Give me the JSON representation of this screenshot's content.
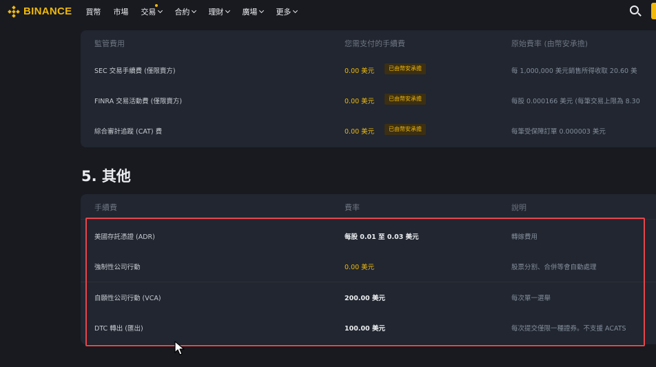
{
  "nav": {
    "brand": "BINANCE",
    "items": [
      {
        "label": "買幣",
        "has_dropdown": false,
        "has_dot": false
      },
      {
        "label": "市場",
        "has_dropdown": false,
        "has_dot": false
      },
      {
        "label": "交易",
        "has_dropdown": true,
        "has_dot": true
      },
      {
        "label": "合約",
        "has_dropdown": true,
        "has_dot": false
      },
      {
        "label": "理財",
        "has_dropdown": true,
        "has_dot": false
      },
      {
        "label": "廣場",
        "has_dropdown": true,
        "has_dot": false
      },
      {
        "label": "更多",
        "has_dropdown": true,
        "has_dot": false
      }
    ]
  },
  "regulatory": {
    "headers": [
      "監管費用",
      "您需支付的手續費",
      "原始費率 (由幣安承擔)"
    ],
    "rows": [
      {
        "name": "SEC 交易手續費 (僅限賣方)",
        "amount": "0.00 美元",
        "badge": "已由幣安承擔",
        "desc": "每 1,000,000 美元銷售所得收取 20.60 美"
      },
      {
        "name": "FINRA 交易活動費 (僅限賣方)",
        "amount": "0.00 美元",
        "badge": "已由幣安承擔",
        "desc": "每股 0.000166 美元 (每筆交易上限為 8.30"
      },
      {
        "name": "綜合審計追蹤 (CAT) 費",
        "amount": "0.00 美元",
        "badge": "已由幣安承擔",
        "desc": "每筆受保障訂單 0.000003 美元"
      }
    ]
  },
  "other": {
    "title": "5. 其他",
    "headers": [
      "手續費",
      "費率",
      "說明"
    ],
    "rows": [
      {
        "name": "美國存託憑證 (ADR)",
        "amount": "每股 0.01 至 0.03 美元",
        "amount_color": "white",
        "desc": "轉嫁費用"
      },
      {
        "name": "強制性公司行動",
        "amount": "0.00 美元",
        "amount_color": "yellow",
        "desc": "股票分割、合併等會自動處理"
      },
      {
        "name": "自願性公司行動 (VCA)",
        "amount": "200.00 美元",
        "amount_color": "white",
        "desc": "每次單一選舉"
      },
      {
        "name": "DTC 轉出 (匯出)",
        "amount": "100.00 美元",
        "amount_color": "white",
        "desc": "每次提交僅限一種證券。不支援 ACATS"
      }
    ]
  },
  "colors": {
    "brand": "#f0b90b",
    "background": "#181a20",
    "card": "#212630",
    "highlight": "#e8454a"
  },
  "icons": [
    "binance-logo-icon",
    "search-icon",
    "cursor-pointer-icon"
  ]
}
